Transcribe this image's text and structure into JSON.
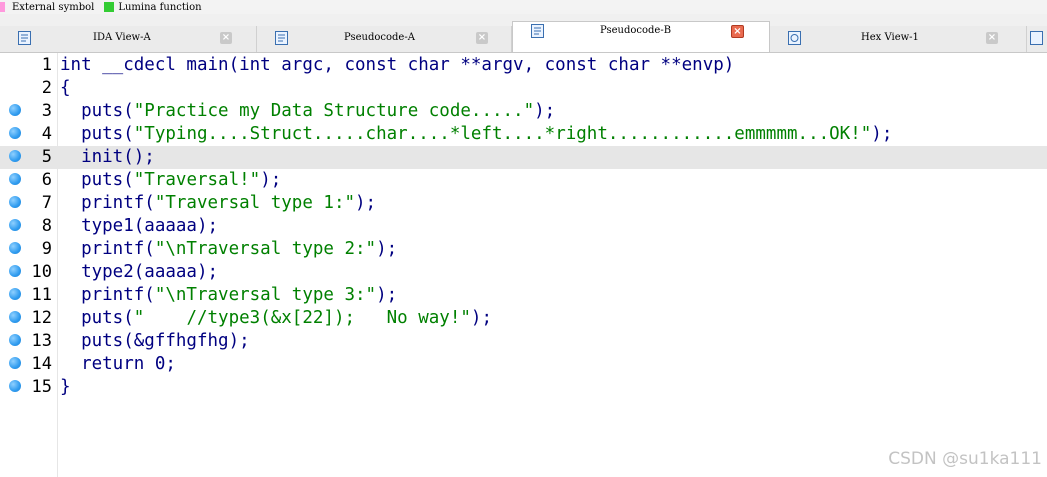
{
  "legend": {
    "items": [
      {
        "label": "External symbol",
        "color": "#ff99dd"
      },
      {
        "label": "Lumina function",
        "color": "#33cc33"
      }
    ]
  },
  "tabs": [
    {
      "label": "IDA View-A",
      "icon": "disassembly-icon",
      "active": false
    },
    {
      "label": "Pseudocode-A",
      "icon": "pseudocode-icon",
      "active": false
    },
    {
      "label": "Pseudocode-B",
      "icon": "pseudocode-icon",
      "active": true
    },
    {
      "label": "Hex View-1",
      "icon": "hex-view-icon",
      "active": false
    }
  ],
  "close_glyph": "×",
  "code": {
    "lines": [
      {
        "num": "1",
        "breakpoint": false,
        "highlight": false,
        "text": "int __cdecl main(int argc, const char **argv, const char **envp)",
        "string_part": ""
      },
      {
        "num": "2",
        "breakpoint": false,
        "highlight": false,
        "text": "{",
        "string_part": ""
      },
      {
        "num": "3",
        "breakpoint": true,
        "highlight": false,
        "pre": "  puts(",
        "string_part": "\"Practice my Data Structure code.....\"",
        "post": ");"
      },
      {
        "num": "4",
        "breakpoint": true,
        "highlight": false,
        "pre": "  puts(",
        "string_part": "\"Typing....Struct.....char....*left....*right............emmmmm...OK!\"",
        "post": ");"
      },
      {
        "num": "5",
        "breakpoint": true,
        "highlight": true,
        "text": "  init();",
        "string_part": ""
      },
      {
        "num": "6",
        "breakpoint": true,
        "highlight": false,
        "pre": "  puts(",
        "string_part": "\"Traversal!\"",
        "post": ");"
      },
      {
        "num": "7",
        "breakpoint": true,
        "highlight": false,
        "pre": "  printf(",
        "string_part": "\"Traversal type 1:\"",
        "post": ");"
      },
      {
        "num": "8",
        "breakpoint": true,
        "highlight": false,
        "text": "  type1(aaaaa);",
        "string_part": ""
      },
      {
        "num": "9",
        "breakpoint": true,
        "highlight": false,
        "pre": "  printf(",
        "string_part": "\"\\nTraversal type 2:\"",
        "post": ");"
      },
      {
        "num": "10",
        "breakpoint": true,
        "highlight": false,
        "text": "  type2(aaaaa);",
        "string_part": ""
      },
      {
        "num": "11",
        "breakpoint": true,
        "highlight": false,
        "pre": "  printf(",
        "string_part": "\"\\nTraversal type 3:\"",
        "post": ");"
      },
      {
        "num": "12",
        "breakpoint": true,
        "highlight": false,
        "pre": "  puts(",
        "string_part": "\"    //type3(&x[22]);   No way!\"",
        "post": ");"
      },
      {
        "num": "13",
        "breakpoint": true,
        "highlight": false,
        "text": "  puts(&gffhgfhg);",
        "string_part": ""
      },
      {
        "num": "14",
        "breakpoint": true,
        "highlight": false,
        "text": "  return 0;",
        "string_part": ""
      },
      {
        "num": "15",
        "breakpoint": true,
        "highlight": false,
        "text": "}",
        "string_part": ""
      }
    ]
  },
  "watermark": "CSDN @su1ka111",
  "colors": {
    "keyword_text": "#000080",
    "string_text": "#008000",
    "highlight_line": "#e6e6e6",
    "active_close": "#e96a4f"
  }
}
